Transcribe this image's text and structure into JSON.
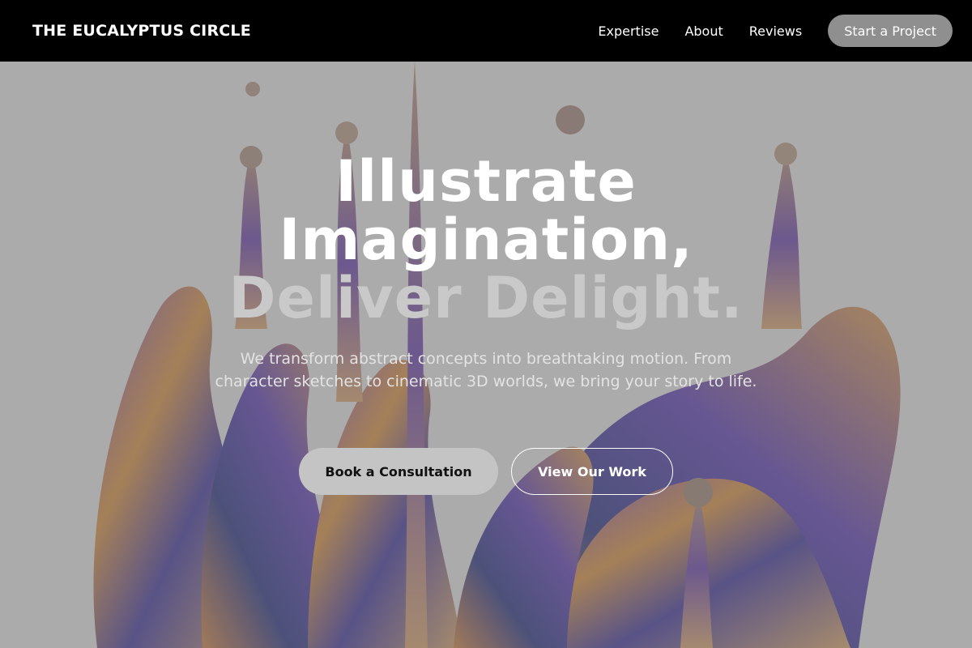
{
  "header": {
    "brand": "THE EUCALYPTUS CIRCLE",
    "nav": [
      "Expertise",
      "About",
      "Reviews"
    ],
    "cta": "Start a Project"
  },
  "hero": {
    "headline": {
      "line1": "Illustrate",
      "line2": "Imagination,",
      "line3": "Deliver Delight."
    },
    "subtext": "We transform abstract concepts into breathtaking motion. From character sketches to cinematic 3D worlds, we bring your story to life.",
    "primary_button": "Book a Consultation",
    "secondary_button": "View Our Work",
    "background_image": "iridescent-liquid-splash",
    "colors": {
      "overlay": "#6b6b6b",
      "headline_accent": "#c9c9c9",
      "primary_button_bg": "#c4c4c4",
      "header_bg": "#000000",
      "header_cta_bg": "#8f8f8f"
    }
  }
}
